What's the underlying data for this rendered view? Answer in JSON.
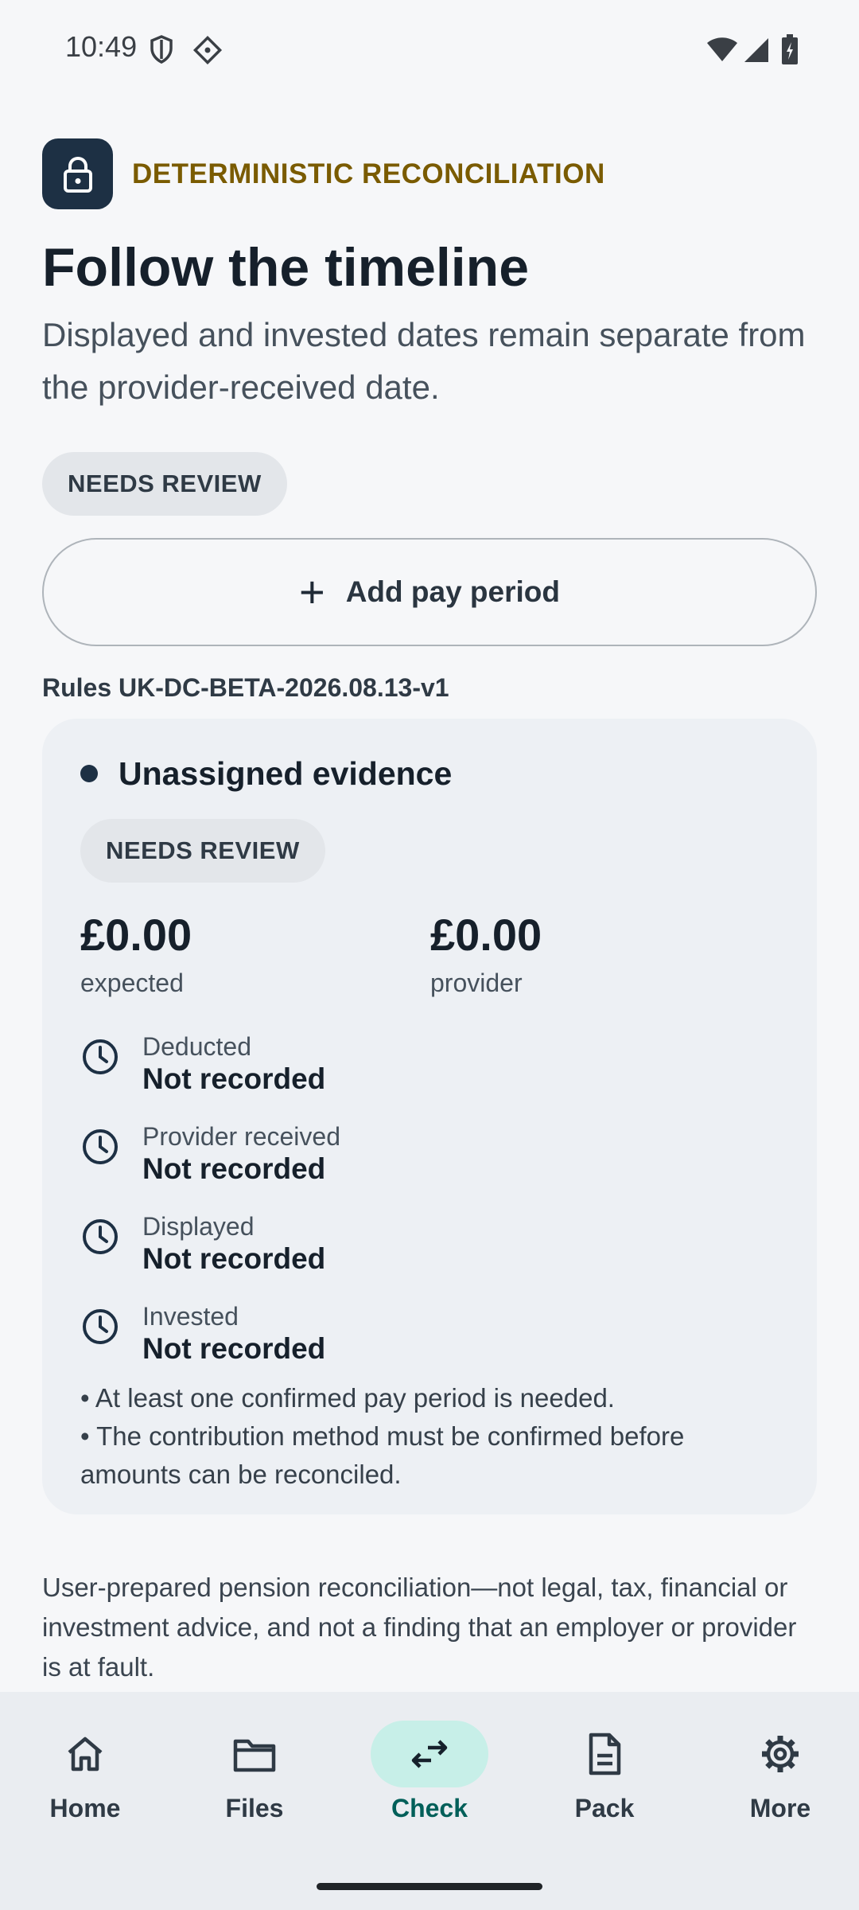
{
  "status_bar": {
    "time": "10:49"
  },
  "header": {
    "eyebrow": "DETERMINISTIC RECONCILIATION",
    "title": "Follow the timeline",
    "subtitle": "Displayed and invested dates remain separate from the provider-received date.",
    "status_chip": "NEEDS REVIEW"
  },
  "actions": {
    "add_pay_period": "Add pay period"
  },
  "rules_version": "Rules UK-DC-BETA-2026.08.13-v1",
  "card": {
    "title": "Unassigned evidence",
    "status_chip": "NEEDS REVIEW",
    "expected_amount": "£0.00",
    "expected_caption": "expected",
    "provider_amount": "£0.00",
    "provider_caption": "provider",
    "timeline": [
      {
        "label": "Deducted",
        "value": "Not recorded"
      },
      {
        "label": "Provider received",
        "value": "Not recorded"
      },
      {
        "label": "Displayed",
        "value": "Not recorded"
      },
      {
        "label": "Invested",
        "value": "Not recorded"
      }
    ],
    "notes": [
      "• At least one confirmed pay period is needed.",
      "• The contribution method must be confirmed before amounts can be reconciled."
    ]
  },
  "disclaimer": "User-prepared pension reconciliation—not legal, tax, financial or investment advice, and not a finding that an employer or provider is at fault.",
  "nav": {
    "active": "Check",
    "items": [
      {
        "label": "Home",
        "icon": "home-icon"
      },
      {
        "label": "Files",
        "icon": "folder-icon"
      },
      {
        "label": "Check",
        "icon": "compare-arrows-icon"
      },
      {
        "label": "Pack",
        "icon": "document-icon"
      },
      {
        "label": "More",
        "icon": "gear-icon"
      }
    ]
  },
  "colors": {
    "accent": "#7a5b00",
    "primary_dark": "#1d3044",
    "active_nav": "#c7efe8"
  }
}
